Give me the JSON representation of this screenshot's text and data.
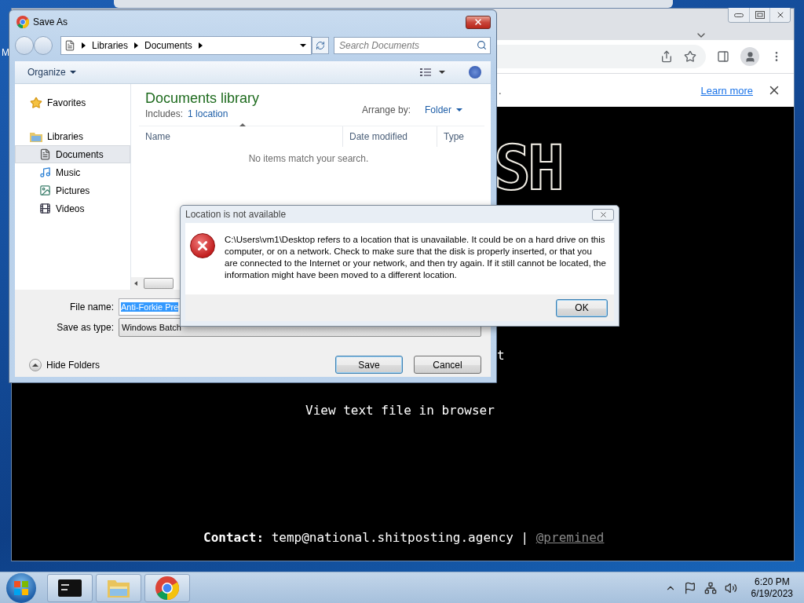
{
  "desktop": {
    "icon_label_fragment": "M"
  },
  "browser": {
    "infobar": {
      "text_fragment": ".",
      "link": "Learn more"
    },
    "page": {
      "banner_fragment": "SH",
      "line_fragment": "t",
      "link_text": "View text file in browser",
      "contact_label": "Contact:",
      "contact_email": "temp@national.shitposting.agency",
      "separator": "|",
      "handle": "@premined"
    }
  },
  "save_dialog": {
    "title": "Save As",
    "breadcrumbs": [
      "Libraries",
      "Documents"
    ],
    "search_placeholder": "Search Documents",
    "organize": "Organize",
    "nav": [
      {
        "label": "Favorites",
        "kind": "favorites",
        "selected": false
      },
      {
        "label": "Libraries",
        "kind": "library",
        "selected": false,
        "children": [
          {
            "label": "Documents",
            "kind": "documents",
            "selected": true
          },
          {
            "label": "Music",
            "kind": "music",
            "selected": false
          },
          {
            "label": "Pictures",
            "kind": "pictures",
            "selected": false
          },
          {
            "label": "Videos",
            "kind": "videos",
            "selected": false
          }
        ]
      }
    ],
    "library": {
      "title": "Documents library",
      "includes_label": "Includes:",
      "includes_link": "1 location",
      "arrange_label": "Arrange by:",
      "arrange_value": "Folder"
    },
    "columns": [
      "Name",
      "Date modified",
      "Type"
    ],
    "empty_message": "No items match your search.",
    "file_name_label": "File name:",
    "file_name": {
      "value": "Anti-Forkie Pre",
      "selected": true
    },
    "type_label": "Save as type:",
    "type_value": "Windows Batch",
    "hide_folders": "Hide Folders",
    "buttons": [
      "Save",
      "Cancel"
    ]
  },
  "error_dialog": {
    "title": "Location is not available",
    "message": "C:\\Users\\vm1\\Desktop refers to a location that is unavailable. It could be on a hard drive on this computer, or on a network. Check to make sure that the disk is properly inserted, or that you are connected to the Internet or your network, and then try again. If it still cannot be located, the information might have been moved to a different location.",
    "button": "OK"
  },
  "taskbar": {
    "apps": [
      {
        "kind": "terminal"
      },
      {
        "kind": "explorer"
      },
      {
        "kind": "chrome"
      }
    ],
    "time": "6:20 PM",
    "date": "6/19/2023"
  }
}
